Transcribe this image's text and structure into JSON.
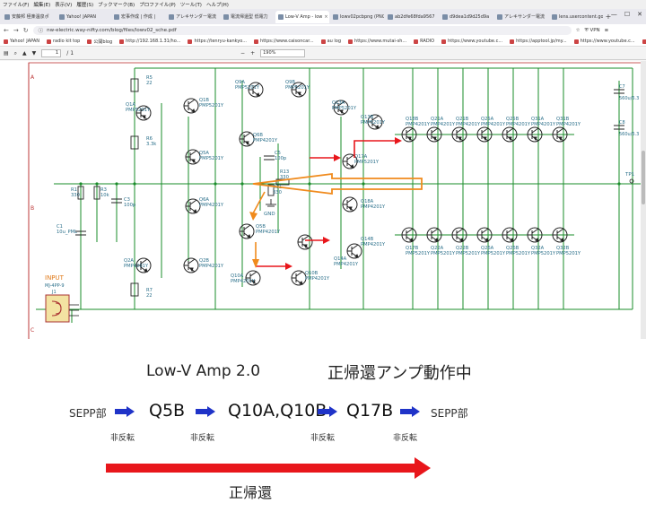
{
  "browser": {
    "menu": [
      "ファイル(F)",
      "編集(E)",
      "表示(V)",
      "履歴(S)",
      "ブックマーク(B)",
      "プロファイル(P)",
      "ツール(T)",
      "ヘルプ(H)"
    ],
    "tabs": [
      {
        "label": "安藤邦 極楽温泉ポ"
      },
      {
        "label": "Yahoo! JAPAN"
      },
      {
        "label": "宏事作成 | 作成 |"
      },
      {
        "label": "アレキサンダー電流"
      },
      {
        "label": "電流帰還型 低電力"
      },
      {
        "label": "Low-V Amp - low"
      },
      {
        "label": "lowv02pcbpng (PNG"
      },
      {
        "label": "ab2dfe68fda9567"
      },
      {
        "label": "d9dea1d9d25d9a"
      },
      {
        "label": "アレキサンダー電流"
      },
      {
        "label": "lens.usercontent.googl"
      }
    ],
    "active_tab_index": 5,
    "url": "nw-electric.way-nifty.com/blog/files/lowv02_sche.pdf",
    "vpn_label": "VPN",
    "bookmarks": [
      "Yahoo! JAPAN",
      "radio kit top",
      "公開blog",
      "http://192.168.1.31/ho...",
      "https://tenryu-kankyo...",
      "https://www.caisoncar...",
      "au log",
      "https://www.mutai-sh...",
      "RADIO",
      "https://www.youtube.c...",
      "https://apptool.jp/my...",
      "https://www.youtube.c...",
      "https://www.youtube.c..."
    ],
    "pdf": {
      "page": "1",
      "page_total": "/ 1",
      "zoom": "190%"
    }
  },
  "schematic": {
    "row_letters": [
      "A",
      "B",
      "C"
    ],
    "input_label": "INPUT",
    "input_connector": "MJ-4PP-9",
    "input_ref": "J1",
    "tp_label": "TP1",
    "cap_labels": [
      "C7",
      "560u/6.3",
      "C8",
      "560u/6.3"
    ],
    "components": [
      {
        "ref": "R5",
        "val": "22"
      },
      {
        "ref": "Q1A",
        "val": "PMP5201Y"
      },
      {
        "ref": "Q1B",
        "val": "PMP5201Y"
      },
      {
        "ref": "Q9A",
        "val": "PMP5201Y"
      },
      {
        "ref": "Q9B",
        "val": "PMP5201Y"
      },
      {
        "ref": "R6",
        "val": "3.3k"
      },
      {
        "ref": "Q5A",
        "val": "PMP5201Y"
      },
      {
        "ref": "Q6B",
        "val": "PMP4201Y"
      },
      {
        "ref": "Q13A",
        "val": "PMP5201Y"
      },
      {
        "ref": "Q13B",
        "val": "PMP5201Y"
      },
      {
        "ref": "C5",
        "val": "100p"
      },
      {
        "ref": "R13",
        "val": "330"
      },
      {
        "ref": "R11",
        "val": "330"
      },
      {
        "ref": "Q17A",
        "val": "PMP5201Y"
      },
      {
        "ref": "R1",
        "val": "330"
      },
      {
        "ref": "R3",
        "val": "10k"
      },
      {
        "ref": "C3",
        "val": "100p"
      },
      {
        "ref": "Q6A",
        "val": "PMP4201Y"
      },
      {
        "ref": "Q18A",
        "val": "PMP4201Y"
      },
      {
        "ref": "C1",
        "val": "10u_PML"
      },
      {
        "ref": "Q5B",
        "val": "PMP4201Y"
      },
      {
        "ref": "Q14B",
        "val": "PMP4201Y"
      },
      {
        "ref": "Q2A",
        "val": "PMP4201Y"
      },
      {
        "ref": "Q2B",
        "val": "PMP4201Y"
      },
      {
        "ref": "Q14A",
        "val": "PMP4201Y"
      },
      {
        "ref": "Q10A",
        "val": "PMP4201Y"
      },
      {
        "ref": "Q10B",
        "val": "PMP4201Y"
      },
      {
        "ref": "R7",
        "val": "22"
      }
    ],
    "gnd_label": "GND",
    "output_upper": [
      "Q18B",
      "Q21A",
      "Q21B",
      "Q25A",
      "Q25B",
      "Q31A",
      "Q31B"
    ],
    "output_lower": [
      "Q17B",
      "Q22A",
      "Q22B",
      "Q26A",
      "Q26B",
      "Q32A",
      "Q32B"
    ],
    "output_upper_part": "PMP4201Y",
    "output_lower_part": "PMP5201Y"
  },
  "caption": {
    "title": "Low-V Amp 2.0",
    "subtitle": "正帰還アンプ動作中",
    "chain": [
      "SEPP部",
      "Q5B",
      "Q10A,Q10B",
      "Q17B",
      "SEPP部"
    ],
    "inversions": [
      "非反転",
      "非反転",
      "非反転",
      "非反転"
    ],
    "feedback_label": "正帰還",
    "colors": {
      "arrow_blue": "#1f33c8",
      "arrow_red": "#e8161b",
      "trace_red": "#e8161b",
      "trace_orange": "#f08a1c",
      "wire_green": "#1a8c2a",
      "label_teal": "#2a6f8a"
    }
  }
}
